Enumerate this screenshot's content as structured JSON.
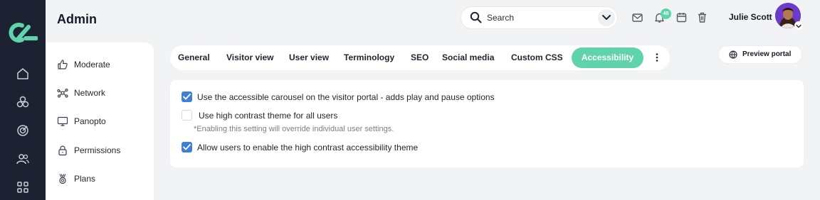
{
  "header": {
    "title": "Admin",
    "search_placeholder": "Search",
    "notification_count": "45",
    "user_name": "Julie Scott"
  },
  "rail": {
    "icons": [
      "home-icon",
      "modules-icon",
      "target-icon",
      "users-icon",
      "apps-grid-icon"
    ]
  },
  "sidebar": {
    "items": [
      {
        "label": "Moderate",
        "icon": "thumbs-up-icon"
      },
      {
        "label": "Network",
        "icon": "network-icon"
      },
      {
        "label": "Panopto",
        "icon": "monitor-icon"
      },
      {
        "label": "Permissions",
        "icon": "lock-icon"
      },
      {
        "label": "Plans",
        "icon": "medal-icon"
      }
    ]
  },
  "tabs": [
    {
      "label": "General",
      "active": false
    },
    {
      "label": "Visitor view",
      "active": false
    },
    {
      "label": "User view",
      "active": false
    },
    {
      "label": "Terminology",
      "active": false
    },
    {
      "label": "SEO",
      "active": false
    },
    {
      "label": "Social media",
      "active": false
    },
    {
      "label": "Custom CSS",
      "active": false
    },
    {
      "label": "Accessibility",
      "active": true
    }
  ],
  "preview_button": {
    "label": "Preview portal"
  },
  "options": [
    {
      "label": "Use the accessible carousel on the visitor portal - adds play and pause options",
      "checked": true
    },
    {
      "label": "Use high contrast theme for all users",
      "checked": false,
      "note": "*Enabling this setting will override individual user settings."
    },
    {
      "label": "Allow users to enable the high contrast accessibility theme",
      "checked": true
    }
  ],
  "colors": {
    "accent": "#5fd3aa",
    "checkbox": "#3f7fd6",
    "rail": "#1c2232"
  }
}
